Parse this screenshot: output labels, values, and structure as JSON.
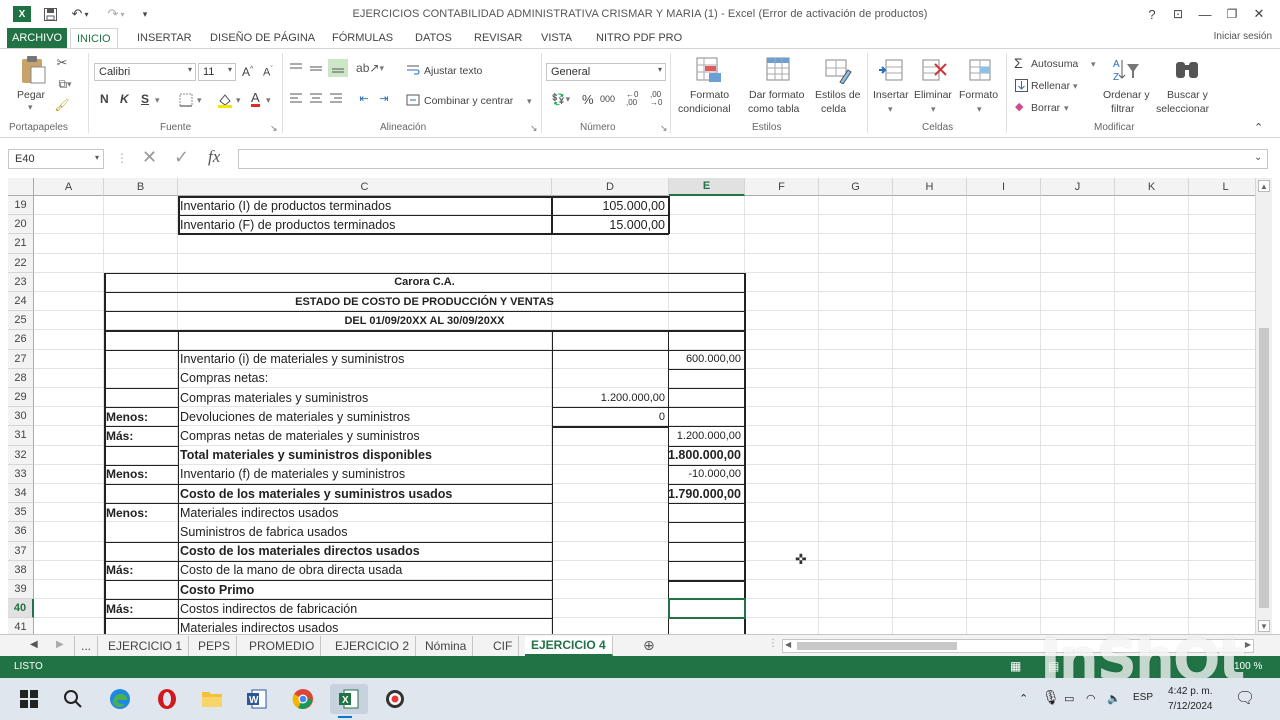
{
  "window": {
    "title": "EJERCICIOS CONTABILIDAD ADMINISTRATIVA CRISMAR Y MARIA (1) - Excel (Error de activación de productos)",
    "controls": {
      "help": "?",
      "restore_ribbon": "⊡",
      "minimize": "—",
      "maximize": "🗗",
      "close": "✕"
    }
  },
  "ribbon_tabs": [
    "ARCHIVO",
    "INICIO",
    "INSERTAR",
    "DISEÑO DE PÁGINA",
    "FÓRMULAS",
    "DATOS",
    "REVISAR",
    "VISTA",
    "NITRO PDF PRO"
  ],
  "active_tab": "INICIO",
  "signin": "Iniciar sesión",
  "ribbon": {
    "clipboard": {
      "paste": "Pegar",
      "label": "Portapapeles"
    },
    "font": {
      "name": "Calibri",
      "size": "11",
      "bold": "N",
      "italic": "K",
      "underline": "S",
      "label": "Fuente"
    },
    "alignment": {
      "wrap": "Ajustar texto",
      "merge": "Combinar y centrar",
      "label": "Alineación"
    },
    "number": {
      "format": "General",
      "percent": "%",
      "thousands": "000",
      "label": "Número"
    },
    "styles": {
      "conditional": [
        "Formato",
        "condicional"
      ],
      "table": [
        "Dar formato",
        "como tabla"
      ],
      "cell_styles": [
        "Estilos de",
        "celda"
      ],
      "label": "Estilos"
    },
    "cells": {
      "insert": "Insertar",
      "delete": "Eliminar",
      "format": "Formato",
      "label": "Celdas"
    },
    "editing": {
      "autosum": "Autosuma",
      "fill": "Rellenar",
      "clear": "Borrar",
      "sort": [
        "Ordenar y",
        "filtrar"
      ],
      "find": [
        "Buscar y",
        "seleccionar"
      ],
      "label": "Modificar"
    }
  },
  "formula_bar": {
    "name_box": "E40",
    "fx": "fx",
    "value": ""
  },
  "columns": [
    "A",
    "B",
    "C",
    "D",
    "E",
    "F",
    "G",
    "H",
    "I",
    "J",
    "K",
    "L"
  ],
  "selected_column": "E",
  "rows": [
    "19",
    "20",
    "21",
    "22",
    "23",
    "24",
    "25",
    "26",
    "27",
    "28",
    "29",
    "30",
    "31",
    "32",
    "33",
    "34",
    "35",
    "36",
    "37",
    "38",
    "39",
    "40",
    "41"
  ],
  "selected_row": "40",
  "cells": {
    "c19": "Inventario (I) de productos terminados",
    "d19": "105.000,00",
    "c20": "Inventario (F) de productos terminados",
    "d20": "15.000,00",
    "t23": "Carora C.A.",
    "t24": "ESTADO DE COSTO DE PRODUCCIÓN Y VENTAS",
    "t25": "DEL 01/09/20XX AL 30/09/20XX",
    "c27": "Inventario (i) de materiales y suministros",
    "e27": "600.000,00",
    "c28": "Compras netas:",
    "c29": "Compras materiales y suministros",
    "d29": "1.200.000,00",
    "b30": "Menos:",
    "c30": "Devoluciones de materiales y suministros",
    "d30": "0",
    "b31": "Más:",
    "c31": "Compras netas de materiales y suministros",
    "e31": "1.200.000,00",
    "c32": "Total materiales y suministros disponibles",
    "e32": "1.800.000,00",
    "b33": "Menos:",
    "c33": "Inventario (f) de materiales y suministros",
    "e33": "-10.000,00",
    "c34": "Costo de los materiales y suministros usados",
    "e34": "1.790.000,00",
    "b35": "Menos:",
    "c35": "Materiales indirectos usados",
    "c36": "Suministros de fabrica usados",
    "c37": "Costo de los materiales directos usados",
    "b38": "Más:",
    "c38": "Costo de la mano de obra directa usada",
    "c39": "Costo Primo",
    "b40": "Más:",
    "c40": "Costos indirectos de fabricación",
    "c41": "Materiales indirectos usados"
  },
  "sheet_tabs": [
    "...",
    "EJERCICIO 1",
    "PEPS",
    "PROMEDIO",
    "EJERCICIO 2",
    "Nómina",
    "CIF",
    "EJERCICIO 4"
  ],
  "active_sheet": "EJERCICIO 4",
  "status": {
    "mode": "LISTO",
    "zoom": "100 %"
  },
  "taskbar": {
    "lang": "ESP",
    "time": "4:42 p. m.",
    "date": "7/12/2024"
  },
  "watermark": "InShOt",
  "colors": {
    "excel_green": "#217346",
    "statusbar": "#217346"
  }
}
